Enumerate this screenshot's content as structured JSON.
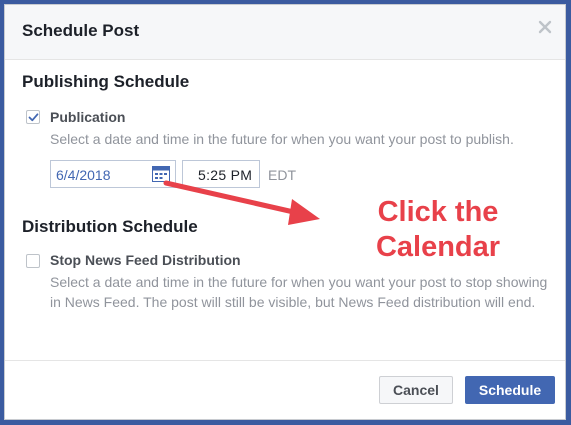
{
  "dialog": {
    "title": "Schedule Post",
    "close_icon": "close-icon"
  },
  "publishing": {
    "section_title": "Publishing Schedule",
    "option_label": "Publication",
    "checked": true,
    "help_text": "Select a date and time in the future for when you want your post to publish.",
    "date_value": "6/4/2018",
    "calendar_icon": "calendar-icon",
    "time_value": "5:25 PM",
    "timezone": "EDT"
  },
  "distribution": {
    "section_title": "Distribution Schedule",
    "option_label": "Stop News Feed Distribution",
    "checked": false,
    "help_text": "Select a date and time in the future for when you want your post to stop showing in News Feed. The post will still be visible, but News Feed distribution will end."
  },
  "annotation": {
    "line1": "Click the",
    "line2": "Calendar",
    "color": "#e8414a"
  },
  "footer": {
    "cancel_label": "Cancel",
    "schedule_label": "Schedule"
  },
  "colors": {
    "accent": "#4267b2",
    "background": "#3b5ba0"
  }
}
